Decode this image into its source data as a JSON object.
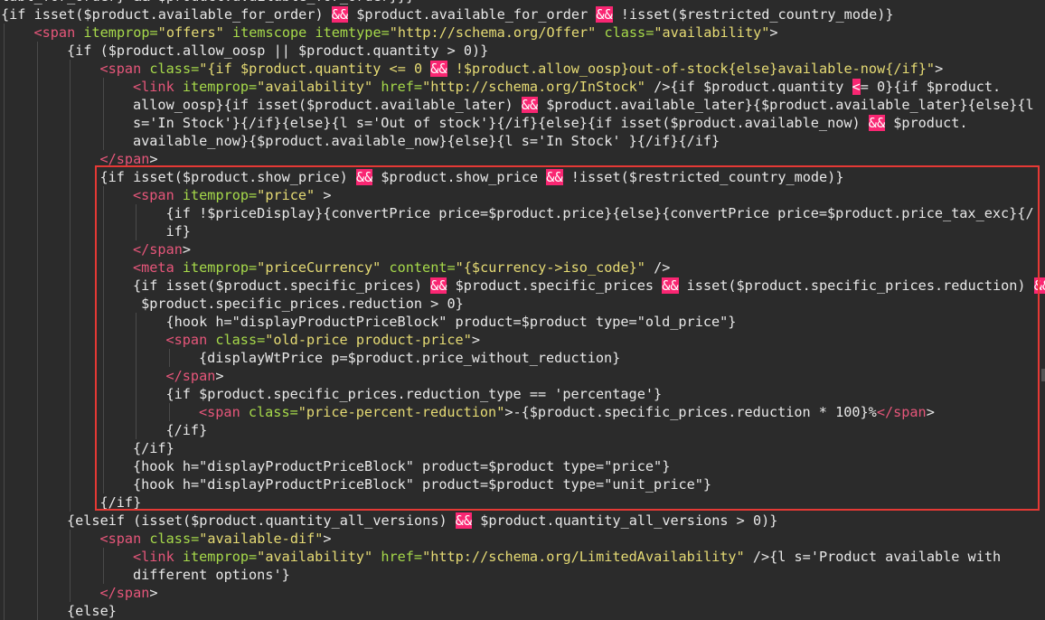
{
  "code": {
    "lines": [
      {
        "indent": 0,
        "tokens": [
          {
            "k": "t",
            "v": "labl_for_order} && $product.available_for_order}}}"
          }
        ]
      },
      {
        "indent": 0,
        "tokens": [
          {
            "k": "t",
            "v": "{if isset($product.available_for_order) "
          },
          {
            "k": "amp",
            "v": "&&"
          },
          {
            "k": "t",
            "v": " $product.available_for_order "
          },
          {
            "k": "amp",
            "v": "&&"
          },
          {
            "k": "t",
            "v": " !isset($restricted_country_mode)}"
          }
        ]
      },
      {
        "indent": 1,
        "tokens": [
          {
            "k": "tag",
            "v": "<span"
          },
          {
            "k": "t",
            "v": " "
          },
          {
            "k": "attr",
            "v": "itemprop="
          },
          {
            "k": "str",
            "v": "\"offers\""
          },
          {
            "k": "t",
            "v": " "
          },
          {
            "k": "attr",
            "v": "itemscope"
          },
          {
            "k": "t",
            "v": " "
          },
          {
            "k": "attr",
            "v": "itemtype="
          },
          {
            "k": "str",
            "v": "\"http://schema.org/Offer\""
          },
          {
            "k": "t",
            "v": " "
          },
          {
            "k": "attr",
            "v": "class="
          },
          {
            "k": "str",
            "v": "\"availability\""
          },
          {
            "k": "t",
            "v": ">"
          }
        ]
      },
      {
        "indent": 2,
        "tokens": [
          {
            "k": "t",
            "v": "{if ($product.allow_oosp || $product.quantity > 0)}"
          }
        ]
      },
      {
        "indent": 3,
        "tokens": [
          {
            "k": "tag",
            "v": "<span"
          },
          {
            "k": "t",
            "v": " "
          },
          {
            "k": "attr",
            "v": "class="
          },
          {
            "k": "str",
            "v": "\"{if $product.quantity <= 0 "
          },
          {
            "k": "amp",
            "v": "&&"
          },
          {
            "k": "str",
            "v": " !$product.allow_oosp}out-of-stock{else}available-now{/if}\""
          },
          {
            "k": "t",
            "v": ">"
          }
        ]
      },
      {
        "indent": 4,
        "tokens": [
          {
            "k": "tag",
            "v": "<link"
          },
          {
            "k": "t",
            "v": " "
          },
          {
            "k": "attr",
            "v": "itemprop="
          },
          {
            "k": "str",
            "v": "\"availability\""
          },
          {
            "k": "t",
            "v": " "
          },
          {
            "k": "attr",
            "v": "href="
          },
          {
            "k": "str",
            "v": "\"http://schema.org/InStock\""
          },
          {
            "k": "t",
            "v": " />{if $product.quantity "
          },
          {
            "k": "amp",
            "v": "<"
          },
          {
            "k": "t",
            "v": "= 0}{if $product."
          }
        ]
      },
      {
        "indent": 4,
        "tokens": [
          {
            "k": "t",
            "v": "allow_oosp}{if isset($product.available_later) "
          },
          {
            "k": "amp",
            "v": "&&"
          },
          {
            "k": "t",
            "v": " $product.available_later}{$product.available_later}{else}{l"
          }
        ]
      },
      {
        "indent": 4,
        "tokens": [
          {
            "k": "t",
            "v": "s='In Stock'}{/if}{else}{l s='Out of stock'}{/if}{else}{if isset($product.available_now) "
          },
          {
            "k": "amp",
            "v": "&&"
          },
          {
            "k": "t",
            "v": " $product."
          }
        ]
      },
      {
        "indent": 4,
        "tokens": [
          {
            "k": "t",
            "v": "available_now}{$product.available_now}{else}{l s='In Stock' }{/if}{/if}"
          }
        ]
      },
      {
        "indent": 3,
        "tokens": [
          {
            "k": "tag",
            "v": "</span"
          },
          {
            "k": "t",
            "v": ">"
          }
        ]
      },
      {
        "indent": 3,
        "tokens": [
          {
            "k": "t",
            "v": "{if isset($product.show_price) "
          },
          {
            "k": "amp",
            "v": "&&"
          },
          {
            "k": "t",
            "v": " $product.show_price "
          },
          {
            "k": "amp",
            "v": "&&"
          },
          {
            "k": "t",
            "v": " !isset($restricted_country_mode)}"
          }
        ]
      },
      {
        "indent": 4,
        "tokens": [
          {
            "k": "tag",
            "v": "<span"
          },
          {
            "k": "t",
            "v": " "
          },
          {
            "k": "attr",
            "v": "itemprop="
          },
          {
            "k": "str",
            "v": "\"price\""
          },
          {
            "k": "t",
            "v": " >"
          }
        ]
      },
      {
        "indent": 5,
        "tokens": [
          {
            "k": "t",
            "v": "{if !$priceDisplay}{convertPrice price=$product.price}{else}{convertPrice price=$product.price_tax_exc}{/"
          }
        ]
      },
      {
        "indent": 5,
        "tokens": [
          {
            "k": "t",
            "v": "if}"
          }
        ]
      },
      {
        "indent": 4,
        "tokens": [
          {
            "k": "tag",
            "v": "</span"
          },
          {
            "k": "t",
            "v": ">"
          }
        ]
      },
      {
        "indent": 4,
        "tokens": [
          {
            "k": "tag",
            "v": "<meta"
          },
          {
            "k": "t",
            "v": " "
          },
          {
            "k": "attr",
            "v": "itemprop="
          },
          {
            "k": "str",
            "v": "\"priceCurrency\""
          },
          {
            "k": "t",
            "v": " "
          },
          {
            "k": "attr",
            "v": "content="
          },
          {
            "k": "str",
            "v": "\"{$currency->iso_code}\""
          },
          {
            "k": "t",
            "v": " />"
          }
        ]
      },
      {
        "indent": 4,
        "tokens": [
          {
            "k": "t",
            "v": "{if isset($product.specific_prices) "
          },
          {
            "k": "amp",
            "v": "&&"
          },
          {
            "k": "t",
            "v": " $product.specific_prices "
          },
          {
            "k": "amp",
            "v": "&&"
          },
          {
            "k": "t",
            "v": " isset($product.specific_prices.reduction) "
          },
          {
            "k": "amp",
            "v": "&&"
          }
        ]
      },
      {
        "indent": 4,
        "tokens": [
          {
            "k": "t",
            "v": " $product.specific_prices.reduction > 0}"
          }
        ]
      },
      {
        "indent": 5,
        "tokens": [
          {
            "k": "t",
            "v": "{hook h=\"displayProductPriceBlock\" product=$product type=\"old_price\"}"
          }
        ]
      },
      {
        "indent": 5,
        "tokens": [
          {
            "k": "tag",
            "v": "<span"
          },
          {
            "k": "t",
            "v": " "
          },
          {
            "k": "attr",
            "v": "class="
          },
          {
            "k": "str",
            "v": "\"old-price product-price\""
          },
          {
            "k": "t",
            "v": ">"
          }
        ]
      },
      {
        "indent": 6,
        "tokens": [
          {
            "k": "t",
            "v": "{displayWtPrice p=$product.price_without_reduction}"
          }
        ]
      },
      {
        "indent": 5,
        "tokens": [
          {
            "k": "tag",
            "v": "</span"
          },
          {
            "k": "t",
            "v": ">"
          }
        ]
      },
      {
        "indent": 5,
        "tokens": [
          {
            "k": "t",
            "v": "{if $product.specific_prices.reduction_type == 'percentage'}"
          }
        ]
      },
      {
        "indent": 6,
        "tokens": [
          {
            "k": "tag",
            "v": "<span"
          },
          {
            "k": "t",
            "v": " "
          },
          {
            "k": "attr",
            "v": "class="
          },
          {
            "k": "str",
            "v": "\"price-percent-reduction\""
          },
          {
            "k": "t",
            "v": ">-{$product.specific_prices.reduction * 100}%"
          },
          {
            "k": "tag",
            "v": "</span"
          },
          {
            "k": "t",
            "v": ">"
          }
        ]
      },
      {
        "indent": 5,
        "tokens": [
          {
            "k": "t",
            "v": "{/if}"
          }
        ]
      },
      {
        "indent": 4,
        "tokens": [
          {
            "k": "t",
            "v": "{/if}"
          }
        ]
      },
      {
        "indent": 4,
        "tokens": [
          {
            "k": "t",
            "v": "{hook h=\"displayProductPriceBlock\" product=$product type=\"price\"}"
          }
        ]
      },
      {
        "indent": 4,
        "tokens": [
          {
            "k": "t",
            "v": "{hook h=\"displayProductPriceBlock\" product=$product type=\"unit_price\"}"
          }
        ]
      },
      {
        "indent": 3,
        "tokens": [
          {
            "k": "t",
            "v": "{/if}"
          }
        ]
      },
      {
        "indent": 2,
        "tokens": [
          {
            "k": "t",
            "v": "{elseif (isset($product.quantity_all_versions) "
          },
          {
            "k": "amp",
            "v": "&&"
          },
          {
            "k": "t",
            "v": " $product.quantity_all_versions > 0)}"
          }
        ]
      },
      {
        "indent": 3,
        "tokens": [
          {
            "k": "tag",
            "v": "<span"
          },
          {
            "k": "t",
            "v": " "
          },
          {
            "k": "attr",
            "v": "class="
          },
          {
            "k": "str",
            "v": "\"available-dif\""
          },
          {
            "k": "t",
            "v": ">"
          }
        ]
      },
      {
        "indent": 4,
        "tokens": [
          {
            "k": "tag",
            "v": "<link"
          },
          {
            "k": "t",
            "v": " "
          },
          {
            "k": "attr",
            "v": "itemprop="
          },
          {
            "k": "str",
            "v": "\"availability\""
          },
          {
            "k": "t",
            "v": " "
          },
          {
            "k": "attr",
            "v": "href="
          },
          {
            "k": "str",
            "v": "\"http://schema.org/LimitedAvailability\""
          },
          {
            "k": "t",
            "v": " />{l s='Product available with"
          }
        ]
      },
      {
        "indent": 4,
        "tokens": [
          {
            "k": "t",
            "v": "different options'}"
          }
        ]
      },
      {
        "indent": 3,
        "tokens": [
          {
            "k": "tag",
            "v": "</span"
          },
          {
            "k": "t",
            "v": ">"
          }
        ]
      },
      {
        "indent": 2,
        "tokens": [
          {
            "k": "t",
            "v": "{else}"
          }
        ]
      }
    ]
  },
  "colors": {
    "background": "#2b2b2b",
    "tag": "#e6567a",
    "attribute": "#a6d94a",
    "string": "#e6db74",
    "operator_highlight": "#f92672",
    "selection_box": "#e53935"
  }
}
